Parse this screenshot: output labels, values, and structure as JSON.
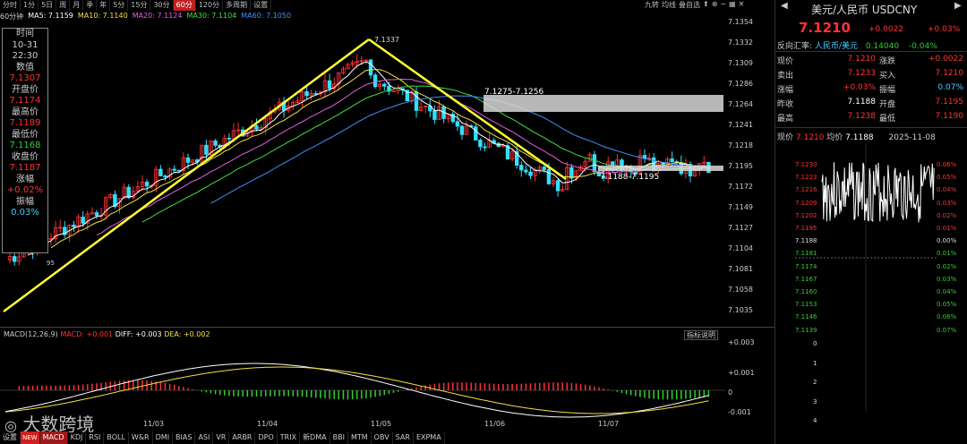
{
  "top_tabs": [
    "分时",
    "1分",
    "5日",
    "周",
    "月",
    "季",
    "年",
    "5分",
    "15分",
    "30分",
    "60分",
    "120分",
    "多周期",
    "设置"
  ],
  "top_tools": [
    "九转",
    "均线",
    "叠自选"
  ],
  "ma_line": {
    "period": "60分钟",
    "ma5": "MA5: 7.1159",
    "ma10": "MA10: 7.1140",
    "ma20": "MA20: 7.1124",
    "ma30": "MA30: 7.1104",
    "ma60": "MA60: 7.1050"
  },
  "colors": {
    "ma5": "#ffffff",
    "ma10": "#f0e040",
    "ma20": "#e060e0",
    "ma30": "#40e040",
    "ma60": "#4090ff",
    "up": "#ff3030",
    "down": "#30e0ff",
    "yellow": "#ffff30"
  },
  "info": {
    "t_label": "时间",
    "date": "10-31",
    "time": "22:30",
    "v_label": "数值",
    "value": "7.1307",
    "o_label": "开盘价",
    "open": "7.1174",
    "h_label": "最高价",
    "high": "7.1189",
    "l_label": "最低价",
    "low": "7.1168",
    "c_label": "收盘价",
    "close": "7.1187",
    "cp_label": "涨幅",
    "chg": "+0.02%",
    "a_label": "振幅",
    "amp": "0.03%"
  },
  "y_axis": [
    "7.1354",
    "7.1332",
    "7.1309",
    "7.1286",
    "7.1264",
    "7.1241",
    "7.1218",
    "7.1195",
    "7.1172",
    "7.1149",
    "7.1127",
    "7.1104",
    "7.1081",
    "7.1058",
    "7.1035"
  ],
  "annotations": {
    "peak": "7.1337",
    "resist": "7.1275-7.1256",
    "support": "7.1188-7.1195",
    "low": "95"
  },
  "macd": {
    "title": "MACD(12,26,9)",
    "macd": "MACD: +0.001",
    "diff": "DIFF: +0.003",
    "dea": "DEA: +0.002",
    "button": "指标说明",
    "y": [
      "+0.003",
      "+0.001",
      "0",
      "-0.001"
    ]
  },
  "dates": [
    "11/03",
    "11/04",
    "11/05",
    "11/06",
    "11/07"
  ],
  "bottom_tabs": [
    "设置",
    "NEW",
    "MACD",
    "KDJ",
    "RSI",
    "BOLL",
    "W&R",
    "DMI",
    "BIAS",
    "ASI",
    "VR",
    "ARBR",
    "DPO",
    "TRIX",
    "新DMA",
    "BBI",
    "MTM",
    "OBV",
    "SAR",
    "EXPMA"
  ],
  "watermark": "大数跨境",
  "panel": {
    "title": "美元/人民币 USDCNY",
    "price": "7.1210",
    "chg": "+0.0022",
    "pct": "+0.03%",
    "rev_label": "反向汇率:",
    "rev_pair": "人民币/美元",
    "rev_val": "0.14040",
    "rev_pct": "-0.04%",
    "rows": [
      {
        "l1": "现价",
        "v1": "7.1210",
        "l2": "涨跌",
        "v2": "+0.0022"
      },
      {
        "l1": "卖出",
        "v1": "7.1233",
        "l2": "买入",
        "v2": "7.1210"
      },
      {
        "l1": "涨幅",
        "v1": "+0.03%",
        "l2": "振幅",
        "v2": "0.07%"
      },
      {
        "l1": "昨收",
        "v1": "7.1188",
        "l2": "开盘",
        "v2": "7.1195"
      },
      {
        "l1": "最高",
        "v1": "7.1238",
        "l2": "最低",
        "v2": "7.1190"
      }
    ],
    "mini_price_label": "现价",
    "mini_price": "7.1210",
    "mini_avg_label": "均价",
    "mini_avg": "7.1188",
    "mini_date": "2025-11-08",
    "mini_left": [
      "7.1230",
      "7.1223",
      "7.1216",
      "7.1209",
      "7.1202",
      "7.1195",
      "7.1188",
      "7.1181",
      "7.1174",
      "7.1167",
      "7.1160",
      "7.1153",
      "7.1146",
      "7.1139"
    ],
    "mini_right": [
      "0.06%",
      "0.05%",
      "0.04%",
      "0.03%",
      "0.02%",
      "0.01%",
      "0.00%",
      "0.01%",
      "0.02%",
      "0.03%",
      "0.04%",
      "0.05%",
      "0.06%",
      "0.07%"
    ],
    "mini_bottom": [
      "0",
      "1",
      "2",
      "3",
      "4"
    ]
  }
}
